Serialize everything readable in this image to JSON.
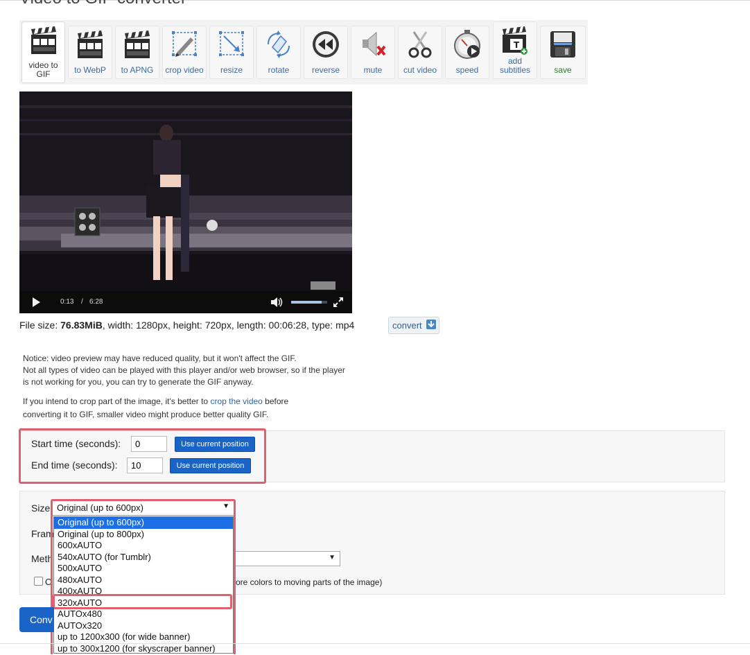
{
  "page": {
    "title": "Video to GIF converter"
  },
  "toolbar": [
    {
      "label": "video to GIF",
      "icon": "clapperboard-icon",
      "active": true
    },
    {
      "label": "to WebP",
      "icon": "clapperboard-icon"
    },
    {
      "label": "to APNG",
      "icon": "clapperboard-icon"
    },
    {
      "label": "crop video",
      "icon": "crop-icon"
    },
    {
      "label": "resize",
      "icon": "resize-icon"
    },
    {
      "label": "rotate",
      "icon": "rotate-icon"
    },
    {
      "label": "reverse",
      "icon": "rewind-icon"
    },
    {
      "label": "mute",
      "icon": "mute-speaker-icon"
    },
    {
      "label": "cut video",
      "icon": "scissors-icon"
    },
    {
      "label": "speed",
      "icon": "stopwatch-icon"
    },
    {
      "label": "add subtitles",
      "icon": "subtitles-clapperboard-icon"
    },
    {
      "label": "save",
      "icon": "floppy-disk-icon"
    }
  ],
  "video": {
    "current_time": "0:13",
    "separator": "/",
    "duration": "6:28",
    "progress": 0.034,
    "volume": 0.85
  },
  "fileinfo": {
    "prefix": "File size: ",
    "size": "76.83MiB",
    "rest": ", width: 1280px, height: 720px, length: 00:06:28, type: mp4",
    "convert_label": "convert"
  },
  "notice": {
    "line1": "Notice: video preview may have reduced quality, but it won't affect the GIF.",
    "line2": "Not all types of video can be played with this player and/or web browser, so if the player",
    "line3": "is not working for you, you can try to generate the GIF anyway.",
    "crop_before": "If you intend to crop part of the image, it's better to ",
    "crop_link": "crop the video",
    "crop_after": " before",
    "crop_line2": "converting it to GIF, smaller video might produce better quality GIF."
  },
  "timing": {
    "start_label": "Start time (seconds):",
    "start_value": "0",
    "end_label": "End time (seconds):",
    "end_value": "10",
    "use_current_label": "Use current position"
  },
  "options": {
    "size_label": "Size:",
    "size_selected": "Original (up to 600px)",
    "size_options": [
      "Original (up to 600px)",
      "Original (up to 800px)",
      "600xAUTO",
      "540xAUTO (for Tumblr)",
      "500xAUTO",
      "480xAUTO",
      "400xAUTO",
      "320xAUTO",
      "AUTOx480",
      "AUTOx320",
      "up to 1200x300 (for wide banner)",
      "up to 300x1200 (for skyscraper banner)"
    ],
    "frame_rate_label_visible": "Fram",
    "method_label_visible": "Meth",
    "checkbox_prefix_visible": "O",
    "checkbox_suffix_visible": "ore colors to moving parts of the image)"
  },
  "convert_main_visible": "Conv",
  "colors": {
    "accent": "#1a64c8",
    "highlight": "#e06070",
    "link": "#2d66a8"
  }
}
